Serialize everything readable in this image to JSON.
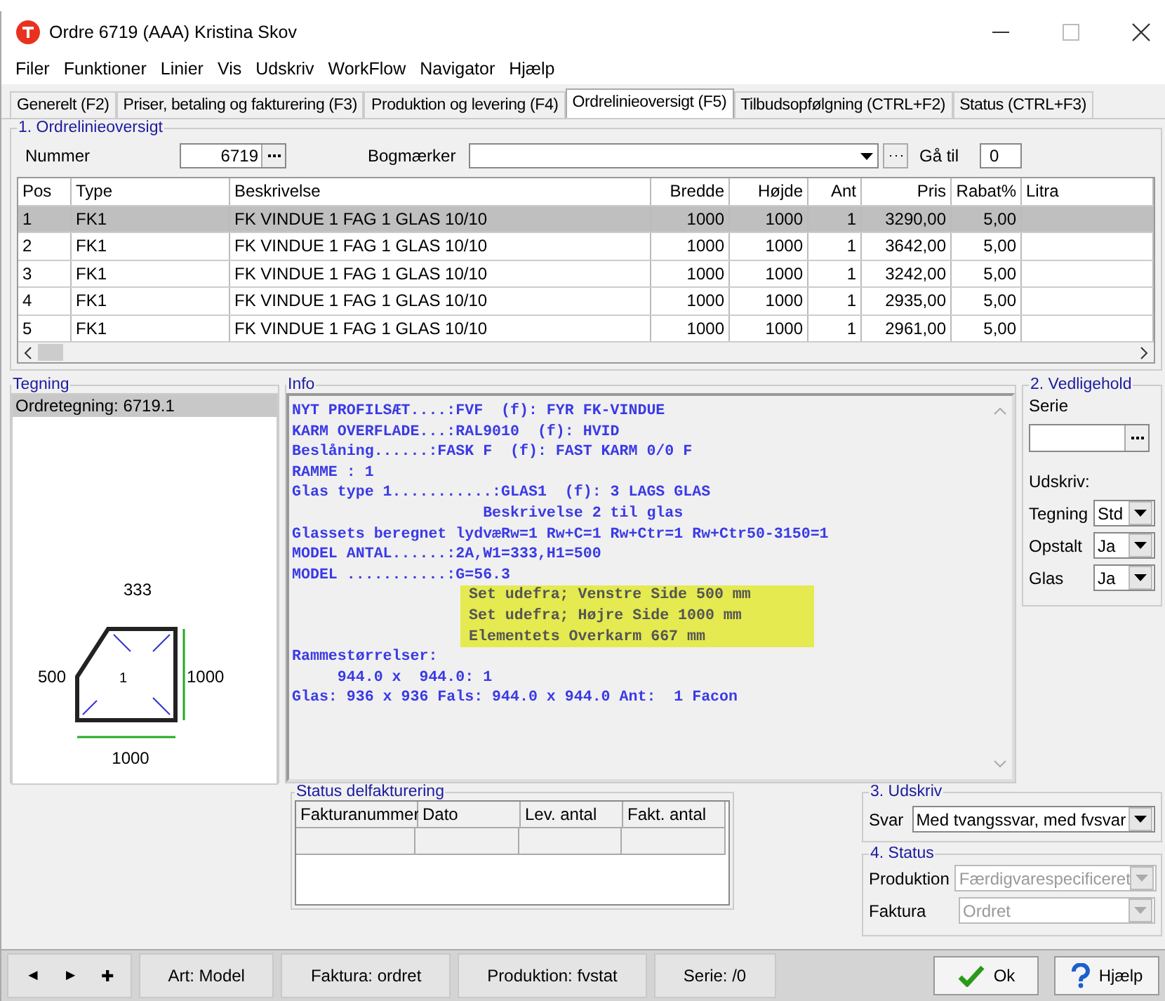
{
  "window": {
    "title": "Ordre  6719  (AAA)  Kristina Skov"
  },
  "menu": [
    "Filer",
    "Funktioner",
    "Linier",
    "Vis",
    "Udskriv",
    "WorkFlow",
    "Navigator",
    "Hjælp"
  ],
  "tabs": [
    {
      "label": "Generelt (F2)",
      "selected": false
    },
    {
      "label": "Priser, betaling og fakturering (F3)",
      "selected": false
    },
    {
      "label": "Produktion og levering (F4)",
      "selected": false
    },
    {
      "label": "Ordrelinieoversigt (F5)",
      "selected": true
    },
    {
      "label": "Tilbudsopfølgning (CTRL+F2)",
      "selected": false
    },
    {
      "label": "Status (CTRL+F3)",
      "selected": false
    }
  ],
  "overview": {
    "title": "1. Ordrelinieoversigt",
    "number_label": "Nummer",
    "number_value": "6719",
    "bookmarks_label": "Bogmærker",
    "goto_label": "Gå til",
    "goto_value": "0"
  },
  "table": {
    "columns": [
      "Pos",
      "Type",
      "Beskrivelse",
      "Bredde",
      "Højde",
      "Ant",
      "Pris",
      "Rabat%",
      "Litra"
    ],
    "rows": [
      {
        "selected": true,
        "cells": [
          "1",
          "FK1",
          "FK VINDUE 1 FAG 1 GLAS 10/10",
          "1000",
          "1000",
          "1",
          "3290,00",
          "5,00",
          ""
        ]
      },
      {
        "selected": false,
        "cells": [
          "2",
          "FK1",
          "FK VINDUE 1 FAG 1 GLAS 10/10",
          "1000",
          "1000",
          "1",
          "3642,00",
          "5,00",
          ""
        ]
      },
      {
        "selected": false,
        "cells": [
          "3",
          "FK1",
          "FK VINDUE 1 FAG 1 GLAS 10/10",
          "1000",
          "1000",
          "1",
          "3242,00",
          "5,00",
          ""
        ]
      },
      {
        "selected": false,
        "cells": [
          "4",
          "FK1",
          "FK VINDUE 1 FAG 1 GLAS 10/10",
          "1000",
          "1000",
          "1",
          "2935,00",
          "5,00",
          ""
        ]
      },
      {
        "selected": false,
        "cells": [
          "5",
          "FK1",
          "FK VINDUE 1 FAG 1 GLAS 10/10",
          "1000",
          "1000",
          "1",
          "2961,00",
          "5,00",
          ""
        ]
      }
    ]
  },
  "drawing_panel": {
    "title": "Tegning",
    "item": "Ordretegning: 6719.1",
    "top_dim": "333",
    "left_dim": "500",
    "right_dim": "1000",
    "bottom_dim": "1000",
    "pane_no": "1"
  },
  "info": {
    "title": "Info",
    "lines": [
      {
        "kind": "text",
        "text": "NYT PROFILSÆT....:FVF  (f): FYR FK-VINDUE"
      },
      {
        "kind": "text",
        "text": "KARM OVERFLADE...:RAL9010  (f): HVID"
      },
      {
        "kind": "text",
        "text": "Beslåning......:FASK F  (f): FAST KARM 0/0 F"
      },
      {
        "kind": "text",
        "text": "RAMME : 1"
      },
      {
        "kind": "text",
        "text": "Glas type 1...........:GLAS1  (f): 3 LAGS GLAS"
      },
      {
        "kind": "text",
        "text": "                     Beskrivelse 2 til glas"
      },
      {
        "kind": "text",
        "text": "Glassets beregnet lydvæRw=1 Rw+C=1 Rw+Ctr=1 Rw+Ctr50-3150=1"
      },
      {
        "kind": "text",
        "text": "MODEL ANTAL......:2A,W1=333,H1=500"
      },
      {
        "kind": "text",
        "text": "MODEL ...........:G=56.3"
      },
      {
        "kind": "note",
        "text": "Set udefra; Venstre Side 500 mm"
      },
      {
        "kind": "note",
        "text": "Set udefra; Højre Side 1000 mm"
      },
      {
        "kind": "note",
        "text": "Elementets Overkarm 667 mm"
      },
      {
        "kind": "text",
        "text": "Rammestørrelser:"
      },
      {
        "kind": "text",
        "text": "     944.0 x  944.0: 1"
      },
      {
        "kind": "text",
        "text": "Glas: 936 x 936 Fals: 944.0 x 944.0 Ant:  1 Facon"
      }
    ]
  },
  "maintenance": {
    "title": "2. Vedligehold",
    "serie_label": "Serie",
    "print_label": "Udskriv:",
    "selects": [
      {
        "label": "Tegning",
        "value": "Std"
      },
      {
        "label": "Opstalt",
        "value": "Ja"
      },
      {
        "label": "Glas",
        "value": "Ja"
      }
    ]
  },
  "invoicing": {
    "title": "Status delfakturering",
    "columns": [
      "Fakturanummer",
      "Dato",
      "Lev. antal",
      "Fakt. antal"
    ]
  },
  "print": {
    "title": "3. Udskriv",
    "label": "Svar",
    "value": "Med tvangssvar, med fvsvar"
  },
  "status": {
    "title": "4. Status",
    "fields": [
      {
        "label": "Produktion",
        "value": "Færdigvarespecificeret",
        "disabled": true
      },
      {
        "label": "Faktura",
        "value": "Ordret",
        "disabled": true
      }
    ]
  },
  "status_bar": {
    "nav": [
      "◄",
      "►",
      "✚"
    ],
    "items": [
      "Art: Model",
      "Faktura: ordret",
      "Produktion: fvstat",
      "Serie: /0"
    ]
  },
  "buttons": [
    {
      "kind": "ok",
      "label": "Ok"
    },
    {
      "kind": "help",
      "label": "Hjælp"
    }
  ]
}
